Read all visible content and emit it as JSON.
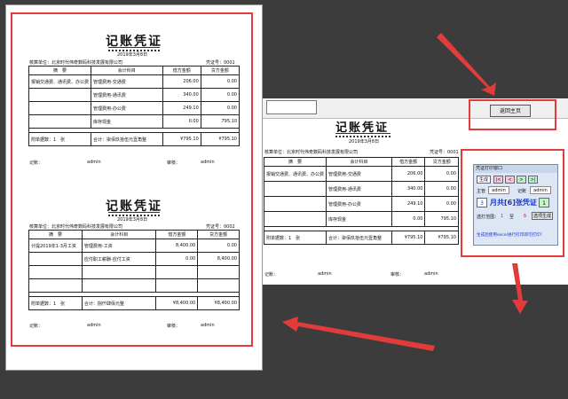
{
  "voucher": {
    "title": "记账凭证",
    "unit_label": "核算单位：北京时代伟奇数码科技发展有限公司",
    "headers": [
      "摘　要",
      "会计科目",
      "借方金额",
      "贷方金额"
    ],
    "page1": {
      "date": "2019年3月8日",
      "number": "凭证号：0001",
      "rows": [
        {
          "summary": "报销交通费、通讯费、办公费",
          "account": "管理费用-交通费",
          "debit": "206.00",
          "credit": "0.00"
        },
        {
          "summary": "",
          "account": "管理费用-通讯费",
          "debit": "340.00",
          "credit": "0.00"
        },
        {
          "summary": "",
          "account": "管理费用-办公费",
          "debit": "249.10",
          "credit": "0.00"
        },
        {
          "summary": "",
          "account": "库存现金",
          "debit": "0.00",
          "credit": "795.10"
        }
      ],
      "attach": "附单据数：1　张",
      "total_text": "合计：柒佰玖拾伍元壹角整",
      "total_debit": "¥795.10",
      "total_credit": "¥795.10",
      "bookkeeper": "记账：",
      "bookkeeper_name": "admin",
      "auditor": "审核：",
      "auditor_name": "admin"
    },
    "page2": {
      "date": "2019年3月8日",
      "number": "凭证号：0002",
      "rows": [
        {
          "summary": "计提2019年1-3月工资",
          "account": "管理费用-工资",
          "debit": "8,400.00",
          "credit": "0.00"
        },
        {
          "summary": "",
          "account": "应付职工薪酬-应付工资",
          "debit": "0.00",
          "credit": "8,400.00"
        },
        {
          "summary": "",
          "account": "",
          "debit": "",
          "credit": ""
        },
        {
          "summary": "",
          "account": "",
          "debit": "",
          "credit": ""
        }
      ],
      "attach": "附单据数：1　张",
      "total_text": "合计：捌仟肆佰元整",
      "total_debit": "¥8,400.00",
      "total_credit": "¥8,400.00",
      "bookkeeper": "记账：",
      "bookkeeper_name": "admin",
      "auditor": "审核：",
      "auditor_name": "admin"
    }
  },
  "screen": {
    "return_button": "返回主页",
    "dialog": {
      "title": "凭证打印窗口",
      "generate": "生成",
      "first": "|<",
      "prev": "<",
      "next": ">",
      "last": ">|",
      "main_label": "主管",
      "main_value": "admin",
      "keeper_label": "记账",
      "keeper_value": "admin",
      "month_no": "3",
      "month_text": "月共[6]张凭证",
      "count": "1",
      "range_label": "选打范围：",
      "range_from": "1",
      "range_to_label": "至",
      "range_to": "6",
      "select_button": "选项生成",
      "note": "生成后使用excel进行打印即可打印！"
    }
  },
  "colors": {
    "highlight": "#e23b3b",
    "background": "#3c3c3c"
  }
}
